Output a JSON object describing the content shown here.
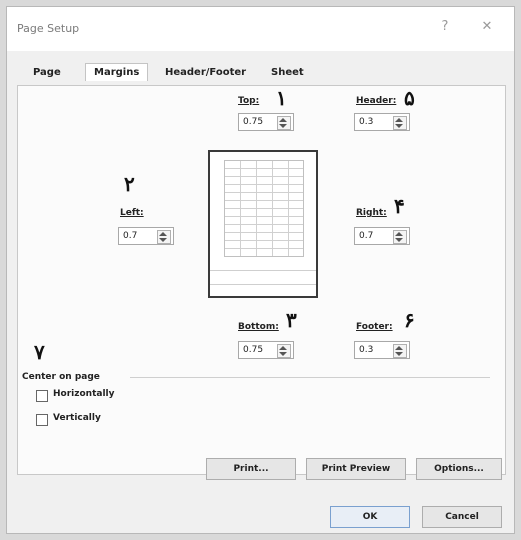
{
  "window": {
    "title": "Page Setup",
    "help_glyph": "?",
    "close_glyph": "✕"
  },
  "tabs": [
    "Page",
    "Margins",
    "Header/Footer",
    "Sheet"
  ],
  "fields": {
    "top": {
      "label": "Top:",
      "value": "0.75"
    },
    "header": {
      "label": "Header:",
      "value": "0.3"
    },
    "left": {
      "label": "Left:",
      "value": "0.7"
    },
    "right": {
      "label": "Right:",
      "value": "0.7"
    },
    "bottom": {
      "label": "Bottom:",
      "value": "0.75"
    },
    "footer": {
      "label": "Footer:",
      "value": "0.3"
    }
  },
  "annotations": {
    "n1": "۱",
    "n2": "۲",
    "n3": "۳",
    "n4": "۴",
    "n5": "۵",
    "n6": "۶",
    "n7": "۷"
  },
  "center": {
    "title": "Center on page",
    "horizontally": "Horizontally",
    "vertically": "Vertically"
  },
  "buttons": {
    "print": "Print...",
    "print_preview": "Print Preview",
    "options": "Options...",
    "ok": "OK",
    "cancel": "Cancel"
  }
}
